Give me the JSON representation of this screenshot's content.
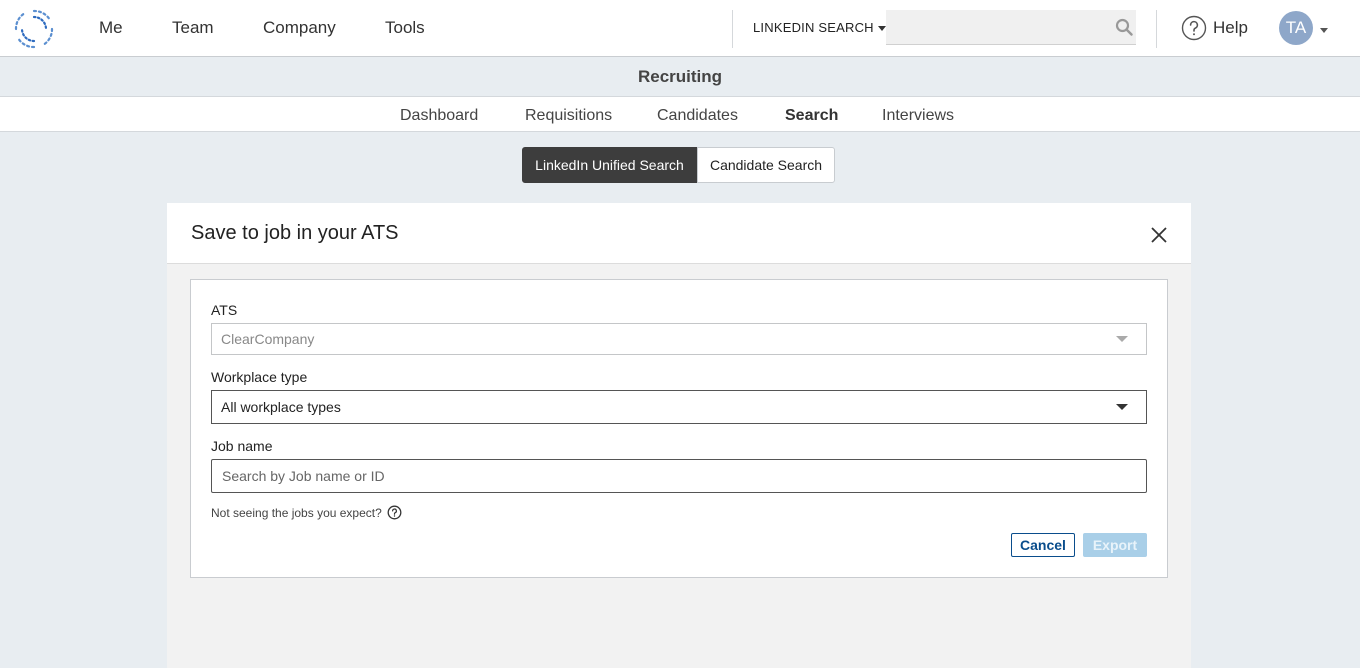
{
  "topnav": {
    "links": [
      {
        "label": "Me"
      },
      {
        "label": "Team"
      },
      {
        "label": "Company"
      },
      {
        "label": "Tools"
      }
    ],
    "search_scope": "LINKEDIN SEARCH",
    "search_placeholder": "",
    "help_label": "Help",
    "avatar_initials": "TA"
  },
  "app": {
    "title": "Recruiting"
  },
  "subnav": {
    "tabs": [
      {
        "label": "Dashboard",
        "active": false
      },
      {
        "label": "Requisitions",
        "active": false
      },
      {
        "label": "Candidates",
        "active": false
      },
      {
        "label": "Search",
        "active": true
      },
      {
        "label": "Interviews",
        "active": false
      }
    ]
  },
  "search_toggle": {
    "options": [
      {
        "label": "LinkedIn Unified Search",
        "active": true
      },
      {
        "label": "Candidate Search",
        "active": false
      }
    ]
  },
  "modal": {
    "title": "Save to job in your ATS",
    "ats": {
      "label": "ATS",
      "value": "ClearCompany",
      "disabled": true
    },
    "workplace": {
      "label": "Workplace type",
      "value": "All workplace types"
    },
    "job": {
      "label": "Job name",
      "placeholder": "Search by Job name or ID",
      "value": ""
    },
    "hint": "Not seeing the jobs you expect?",
    "cancel_label": "Cancel",
    "export_label": "Export",
    "export_disabled": true
  },
  "colors": {
    "primary": "#0a4d8c",
    "export_disabled_bg": "#a9cfe8",
    "segment_active_bg": "#3d3d3d",
    "avatar_bg": "#8ea7c9"
  }
}
